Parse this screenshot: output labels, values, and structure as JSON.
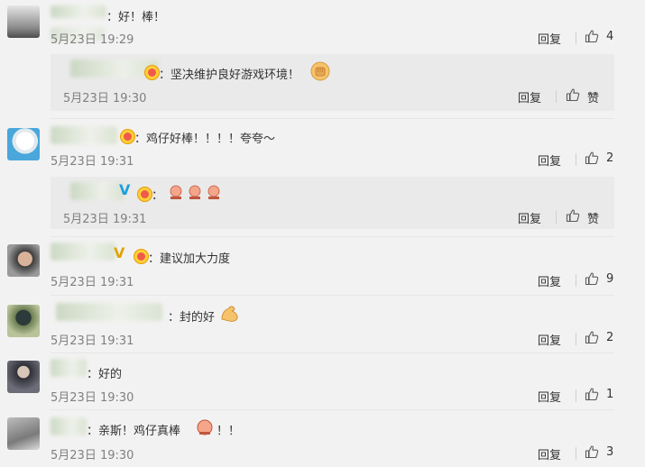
{
  "labels": {
    "reply": "回复",
    "like": "赞"
  },
  "comments": [
    {
      "text": "：好！棒！",
      "time": "5月23日 19:29",
      "likes": "4"
    },
    {
      "text": "：坚决维护良好游戏环境！",
      "time": "5月23日 19:30",
      "sub": true
    },
    {
      "text": "：鸡仔好棒！！！！夸夸～",
      "time": "5月23日 19:31",
      "likes": "2"
    },
    {
      "text": "：",
      "time": "5月23日 19:31",
      "sub": true
    },
    {
      "text": "：建议加大力度",
      "time": "5月23日 19:31",
      "likes": "9"
    },
    {
      "text": "：封的好",
      "time": "5月23日 19:31",
      "likes": "2"
    },
    {
      "text": "：好的",
      "time": "5月23日 19:30",
      "likes": "1"
    },
    {
      "text": "：亲斯！鸡仔真棒",
      "text_tail": "！！",
      "time": "5月23日 19:30",
      "likes": "3"
    }
  ],
  "icons": {
    "thumb": "thumbs-up-icon",
    "fist": "fist-emoji-icon",
    "muscle": "flexed-biceps-emoji-icon",
    "chick": "chick-emoji-icon",
    "crown_badge": "vip-crown-badge-icon",
    "verified": "verified-v-icon"
  },
  "colors": {
    "background": "#f2f2f2",
    "sub_bg": "#eaeaea",
    "text": "#333333",
    "time": "#808080"
  }
}
